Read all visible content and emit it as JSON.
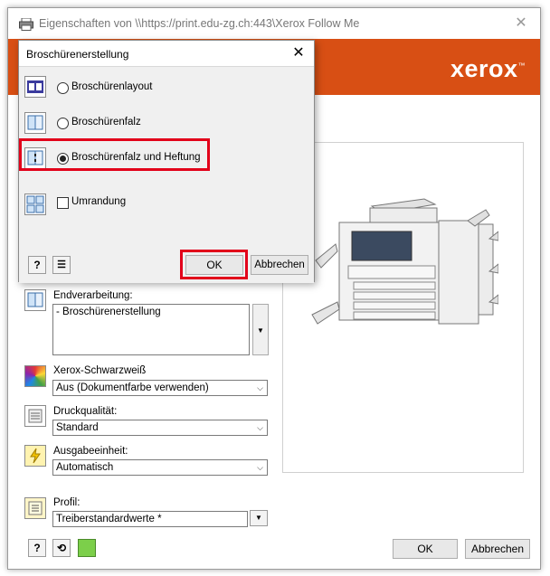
{
  "window": {
    "title": "Eigenschaften von \\\\https://print.edu-zg.ch:443\\Xerox Follow Me",
    "close_glyph": "✕"
  },
  "banner": {
    "logo": "xerox",
    "logo_mark": "™",
    "color": "#d84f14"
  },
  "finishing": {
    "label": "Endverarbeitung:",
    "items": [
      "- Broschürenerstellung"
    ],
    "button_glyph": "▼"
  },
  "bw": {
    "label": "Xerox-Schwarzweiß",
    "value": "Aus (Dokumentfarbe verwenden)"
  },
  "quality": {
    "label": "Druckqualität:",
    "value": "Standard"
  },
  "output": {
    "label": "Ausgabeeinheit:",
    "value": "Automatisch"
  },
  "profile": {
    "label": "Profil:",
    "value": "Treiberstandardwerte *"
  },
  "footer": {
    "help": "?",
    "ok": "OK",
    "cancel": "Abbrechen"
  },
  "dialog": {
    "title": "Broschürenerstellung",
    "close_glyph": "✕",
    "options": [
      {
        "label": "Broschürenlayout",
        "selected": false
      },
      {
        "label": "Broschürenfalz",
        "selected": false
      },
      {
        "label": "Broschürenfalz und Heftung",
        "selected": true
      }
    ],
    "border": {
      "label": "Umrandung",
      "checked": false
    },
    "help": "?",
    "ok": "OK",
    "cancel": "Abbrechen",
    "highlight_color": "#e2001a"
  },
  "icons": {
    "printer": "printer-icon",
    "booklet_layout": "booklet-layout-icon",
    "booklet_fold": "booklet-fold-icon",
    "booklet_staple": "booklet-fold-staple-icon",
    "border": "border-grid-icon",
    "color": "color-mode-icon",
    "quality": "print-quality-icon",
    "output": "output-device-icon",
    "profile": "profile-icon",
    "reset": "reset-icon",
    "green": "status-icon"
  },
  "dropdown_glyph": "▼"
}
